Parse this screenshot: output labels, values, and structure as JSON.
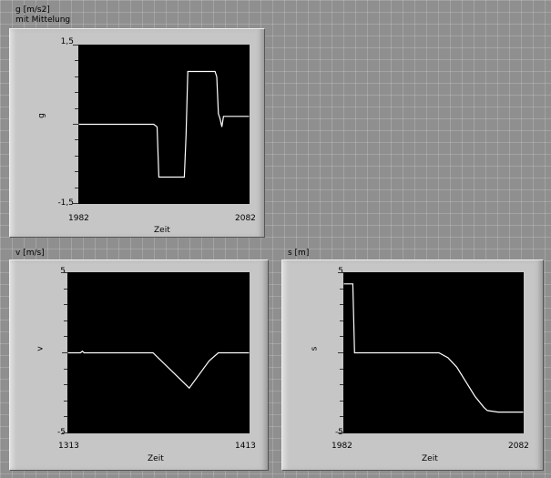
{
  "charts": [
    {
      "caption": "g [m/s2]",
      "subcaption": "mit Mittelung",
      "chart_data": {
        "type": "line",
        "ylabel": "g",
        "xlabel": "Zeit",
        "xlim": [
          1982,
          2082
        ],
        "ylim": [
          -1.5,
          1.5
        ],
        "xticks": [
          "1982",
          "2082"
        ],
        "yticks": [
          "1,5",
          "-1,5"
        ],
        "series": [
          {
            "color": "#ffffff",
            "x": [
              1982,
              2026,
              2028,
              2029,
              2034,
              2044,
              2045,
              2046,
              2062,
              2063,
              2064,
              2065,
              2066,
              2067,
              2068,
              2082
            ],
            "y": [
              0.0,
              0.0,
              -0.05,
              -1.0,
              -1.0,
              -1.0,
              -0.2,
              1.0,
              1.0,
              0.9,
              0.2,
              0.1,
              -0.05,
              0.15,
              0.15,
              0.15
            ]
          }
        ]
      }
    },
    {
      "caption": "v [m/s]",
      "subcaption": "",
      "chart_data": {
        "type": "line",
        "ylabel": "v",
        "xlabel": "Zeit",
        "xlim": [
          1313,
          1413
        ],
        "ylim": [
          -5,
          5
        ],
        "xticks": [
          "1313",
          "1413"
        ],
        "yticks": [
          "5",
          "-5"
        ],
        "series": [
          {
            "color": "#ffffff",
            "x": [
              1313,
              1320,
              1321,
              1322,
              1360,
              1380,
              1391,
              1396,
              1413
            ],
            "y": [
              0.0,
              0.0,
              0.1,
              0.0,
              0.0,
              -2.2,
              -0.5,
              0.0,
              0.0
            ]
          }
        ]
      }
    },
    {
      "caption": "s [m]",
      "subcaption": "",
      "chart_data": {
        "type": "line",
        "ylabel": "s",
        "xlabel": "Zeit",
        "xlim": [
          1982,
          2082
        ],
        "ylim": [
          -5,
          5
        ],
        "xticks": [
          "1982",
          "2082"
        ],
        "yticks": [
          "5",
          "-5"
        ],
        "series": [
          {
            "color": "#ffffff",
            "x": [
              1982,
              1987,
              1988,
              2020,
              2035,
              2040,
              2045,
              2050,
              2055,
              2060,
              2062,
              2068,
              2082
            ],
            "y": [
              4.3,
              4.3,
              0.0,
              0.0,
              0.0,
              -0.3,
              -0.9,
              -1.8,
              -2.7,
              -3.4,
              -3.6,
              -3.7,
              -3.7
            ]
          }
        ]
      }
    }
  ]
}
